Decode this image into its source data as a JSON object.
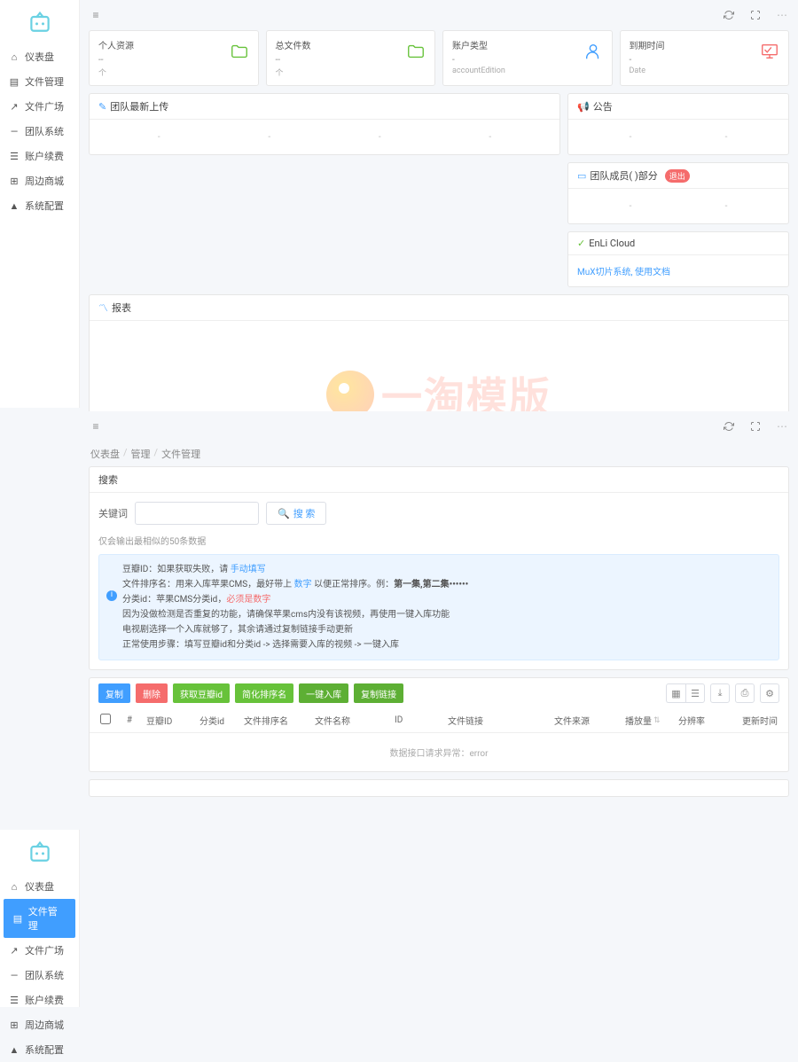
{
  "sidebar": {
    "items": [
      {
        "icon": "dashboard",
        "label": "仪表盘"
      },
      {
        "icon": "folder",
        "label": "文件管理"
      },
      {
        "icon": "share",
        "label": "文件广场"
      },
      {
        "icon": "team",
        "label": "团队系统"
      },
      {
        "icon": "wallet",
        "label": "账户续费"
      },
      {
        "icon": "shop",
        "label": "周边商城"
      },
      {
        "icon": "user",
        "label": "系统配置"
      }
    ]
  },
  "topbar": {
    "collapse": "≡"
  },
  "stats": [
    {
      "title": "个人资源",
      "value": "--",
      "unit": "个",
      "icon": "folder-o",
      "color": "#67c23a"
    },
    {
      "title": "总文件数",
      "value": "--",
      "unit": "个",
      "icon": "folder-o",
      "color": "#67c23a"
    },
    {
      "title": "账户类型",
      "value": "-",
      "unit": "accountEdition",
      "icon": "user-o",
      "color": "#409eff"
    },
    {
      "title": "到期时间",
      "value": "-",
      "unit": "Date",
      "icon": "monitor",
      "color": "#f56c6c"
    }
  ],
  "teamUpload": {
    "title": "团队最新上传"
  },
  "announce": {
    "title": "公告"
  },
  "members": {
    "title": "团队成员( )部分",
    "badge": "退出"
  },
  "cloud": {
    "title": "EnLi Cloud",
    "link": "MuX切片系统, 使用文档"
  },
  "report": {
    "title": "报表"
  },
  "watermark": "一淘模版",
  "breadcrumb": {
    "a": "仪表盘",
    "b": "管理",
    "c": "文件管理"
  },
  "search": {
    "panelTitle": "搜索",
    "inputLabel": "关键词",
    "placeholder": "",
    "btn": "搜 索",
    "tip": "仅会输出最相似的50条数据"
  },
  "alert": {
    "l1a": "豆瓣ID：如果获取失败，请 ",
    "l1b": "手动填写",
    "l2a": "文件排序名：用来入库苹果CMS，最好带上 ",
    "l2b": "数字",
    "l2c": " 以便正常排序。例：",
    "l2d": "第一集,第二集••••••",
    "l3a": "分类id：苹果CMS分类id，",
    "l3b": "必须是数字",
    "l4": "因为没做检测是否重复的功能，请确保苹果cms内没有该视频，再使用一键入库功能",
    "l5": "电视剧选择一个入库就够了，其余请通过复制链接手动更新",
    "l6": "正常使用步骤：填写豆瓣id和分类id -> 选择需要入库的视频 -> 一键入库"
  },
  "toolbarBtns": {
    "copy": "复制",
    "del": "删除",
    "douban": "获取豆瓣id",
    "simplify": "简化排序名",
    "import": "一键入库",
    "copylink": "复制链接"
  },
  "columns": {
    "n": "#",
    "douban": "豆瓣ID",
    "cat": "分类id",
    "sort": "文件排序名",
    "name": "文件名称",
    "id": "ID",
    "link": "文件链接",
    "src": "文件来源",
    "play": "播放量",
    "res": "分辨率",
    "time": "更新时间",
    "sortIc": "⇅"
  },
  "tableEmpty": "数据接口请求异常：error"
}
